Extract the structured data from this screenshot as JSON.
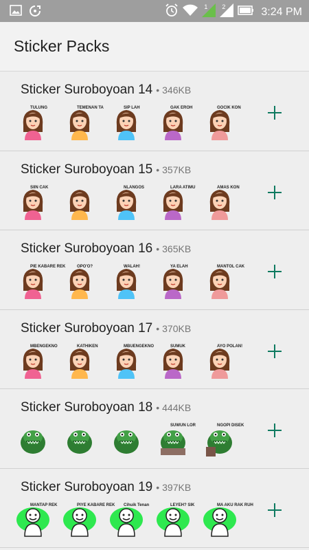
{
  "status_bar": {
    "time": "3:24 PM",
    "signal_1": "1",
    "signal_2": "2",
    "icons": [
      "image-icon",
      "sync-icon",
      "alarm-icon",
      "wifi-icon",
      "signal-icon",
      "signal-icon",
      "battery-icon"
    ]
  },
  "app_bar": {
    "title": "Sticker Packs"
  },
  "packs": [
    {
      "name": "Sticker Suroboyoan 14",
      "size": "346KB",
      "theme": "girl",
      "tags": [
        "TULUNG",
        "TEMENAN TA",
        "SIP LAH",
        "GAK EROH",
        "GOCIK KON"
      ]
    },
    {
      "name": "Sticker Suroboyoan 15",
      "size": "357KB",
      "theme": "girl",
      "tags": [
        "SIIN CAK",
        "",
        "NLANGOS",
        "LARA ATIMU",
        "AMAS KON"
      ]
    },
    {
      "name": "Sticker Suroboyoan 16",
      "size": "365KB",
      "theme": "girl",
      "tags": [
        "PIE KABARE REK",
        "OPO'O?",
        "WALAH!",
        "YA ELAH",
        "MANTOL CAK"
      ]
    },
    {
      "name": "Sticker Suroboyoan 17",
      "size": "370KB",
      "theme": "girl",
      "tags": [
        "MBENGEKNO",
        "KATHIKEN",
        "MBUENGEKNO",
        "SUMUK",
        "AYO POLAN!"
      ]
    },
    {
      "name": "Sticker Suroboyoan 18",
      "size": "444KB",
      "theme": "croc",
      "tags": [
        "",
        "",
        "",
        "SUWUN LOR",
        "NGOPI DISEK"
      ]
    },
    {
      "name": "Sticker Suroboyoan 19",
      "size": "397KB",
      "theme": "green",
      "tags": [
        "MANTAP REK",
        "PIYE KABARE REK",
        "Cihuik Tenan",
        "LEYEH? SIK",
        "MA AKU RAK RUH"
      ]
    }
  ],
  "add_label": "+",
  "colors": {
    "accent": "#0e7a60",
    "status_bar": "#9e9e9e",
    "background": "#eeeeee"
  }
}
